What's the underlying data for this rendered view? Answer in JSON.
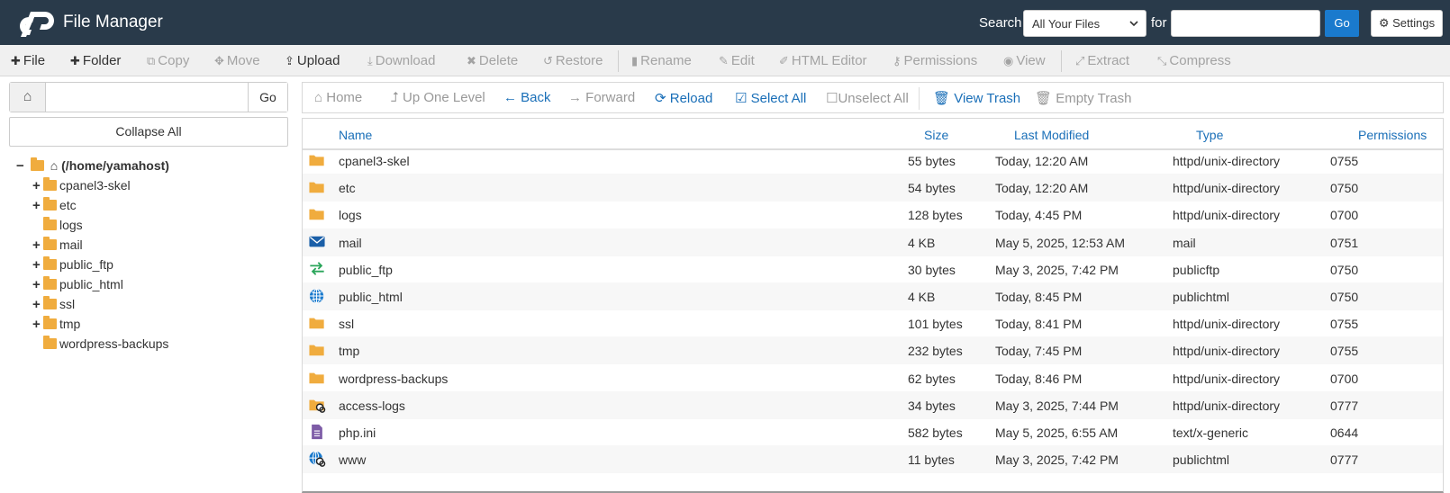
{
  "header": {
    "app_title": "File Manager",
    "search_label": "Search",
    "search_scope": "All Your Files",
    "for_label": "for",
    "search_value": "",
    "go_label": "Go",
    "settings_label": "Settings"
  },
  "toolbar": {
    "file": "File",
    "folder": "Folder",
    "copy": "Copy",
    "move": "Move",
    "upload": "Upload",
    "download": "Download",
    "delete": "Delete",
    "restore": "Restore",
    "rename": "Rename",
    "edit": "Edit",
    "html_editor": "HTML Editor",
    "permissions": "Permissions",
    "view": "View",
    "extract": "Extract",
    "compress": "Compress"
  },
  "left": {
    "path_value": "",
    "go_label": "Go",
    "collapse_label": "Collapse All",
    "root": "(/home/yamahost)",
    "tree": [
      {
        "label": "cpanel3-skel",
        "expand": "+"
      },
      {
        "label": "etc",
        "expand": "+"
      },
      {
        "label": "logs",
        "expand": ""
      },
      {
        "label": "mail",
        "expand": "+"
      },
      {
        "label": "public_ftp",
        "expand": "+"
      },
      {
        "label": "public_html",
        "expand": "+"
      },
      {
        "label": "ssl",
        "expand": "+"
      },
      {
        "label": "tmp",
        "expand": "+"
      },
      {
        "label": "wordpress-backups",
        "expand": ""
      }
    ]
  },
  "nav": {
    "home": "Home",
    "up": "Up One Level",
    "back": "Back",
    "forward": "Forward",
    "reload": "Reload",
    "select_all": "Select All",
    "unselect_all": "Unselect All",
    "view_trash": "View Trash",
    "empty_trash": "Empty Trash"
  },
  "table": {
    "columns": {
      "name": "Name",
      "size": "Size",
      "modified": "Last Modified",
      "type": "Type",
      "perms": "Permissions"
    },
    "rows": [
      {
        "icon": "folder-icon",
        "name": "cpanel3-skel",
        "size": "55 bytes",
        "modified": "Today, 12:20 AM",
        "type": "httpd/unix-directory",
        "perms": "0755"
      },
      {
        "icon": "folder-icon",
        "name": "etc",
        "size": "54 bytes",
        "modified": "Today, 12:20 AM",
        "type": "httpd/unix-directory",
        "perms": "0750"
      },
      {
        "icon": "folder-icon",
        "name": "logs",
        "size": "128 bytes",
        "modified": "Today, 4:45 PM",
        "type": "httpd/unix-directory",
        "perms": "0700"
      },
      {
        "icon": "envelope-icon",
        "name": "mail",
        "size": "4 KB",
        "modified": "May 5, 2025, 12:53 AM",
        "type": "mail",
        "perms": "0751"
      },
      {
        "icon": "transfer-icon",
        "name": "public_ftp",
        "size": "30 bytes",
        "modified": "May 3, 2025, 7:42 PM",
        "type": "publicftp",
        "perms": "0750"
      },
      {
        "icon": "globe-icon",
        "name": "public_html",
        "size": "4 KB",
        "modified": "Today, 8:45 PM",
        "type": "publichtml",
        "perms": "0750"
      },
      {
        "icon": "folder-icon",
        "name": "ssl",
        "size": "101 bytes",
        "modified": "Today, 8:41 PM",
        "type": "httpd/unix-directory",
        "perms": "0755"
      },
      {
        "icon": "folder-icon",
        "name": "tmp",
        "size": "232 bytes",
        "modified": "Today, 7:45 PM",
        "type": "httpd/unix-directory",
        "perms": "0755"
      },
      {
        "icon": "folder-icon",
        "name": "wordpress-backups",
        "size": "62 bytes",
        "modified": "Today, 8:46 PM",
        "type": "httpd/unix-directory",
        "perms": "0700"
      },
      {
        "icon": "folder-link-icon",
        "name": "access-logs",
        "size": "34 bytes",
        "modified": "May 3, 2025, 7:44 PM",
        "type": "httpd/unix-directory",
        "perms": "0777"
      },
      {
        "icon": "file-text-icon",
        "name": "php.ini",
        "size": "582 bytes",
        "modified": "May 5, 2025, 6:55 AM",
        "type": "text/x-generic",
        "perms": "0644"
      },
      {
        "icon": "globe-link-icon",
        "name": "www",
        "size": "11 bytes",
        "modified": "May 3, 2025, 7:42 PM",
        "type": "publichtml",
        "perms": "0777"
      }
    ]
  },
  "colors": {
    "header_bg": "#293a4a",
    "accent": "#1a7acd",
    "folder": "#f0ac3e",
    "link": "#1a6fb8"
  }
}
